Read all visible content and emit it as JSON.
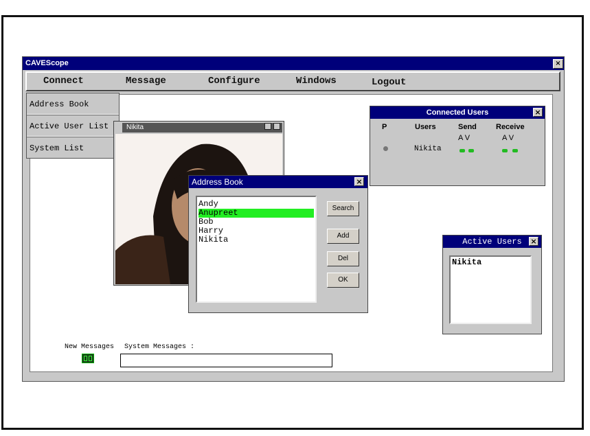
{
  "window": {
    "title": "CAVEScope",
    "close_glyph": "×"
  },
  "menubar": {
    "items": [
      {
        "label": "Connect"
      },
      {
        "label": "Message"
      },
      {
        "label": "Configure"
      },
      {
        "label": "Windows"
      },
      {
        "label": "Logout"
      }
    ]
  },
  "connect_menu": {
    "items": [
      {
        "label": "Address Book"
      },
      {
        "label": "Active User List"
      },
      {
        "label": "System List"
      }
    ]
  },
  "video_window": {
    "title": "Nikita"
  },
  "address_book": {
    "title": "Address Book",
    "close_glyph": "×",
    "entries": [
      "Andy",
      "Anupreet",
      "Bob",
      "Harry",
      "Nikita"
    ],
    "selected_index": 1,
    "buttons": {
      "search": "Search",
      "add": "Add",
      "del": "Del",
      "ok": "OK"
    }
  },
  "connected_users": {
    "title": "Connected Users",
    "close_glyph": "×",
    "headers": {
      "p": "P",
      "users": "Users",
      "send": "Send",
      "receive": "Receive"
    },
    "send_sub": "A  V",
    "receive_sub": "A  V",
    "rows": [
      {
        "user": "Nikita"
      }
    ]
  },
  "active_users": {
    "title": "Active Users",
    "close_glyph": "×",
    "entries": [
      "Nikita"
    ]
  },
  "status": {
    "new_messages_label": "New Messages",
    "system_messages_label": "System Messages :",
    "system_messages_value": ""
  },
  "colors": {
    "titlebar": "#00007a",
    "selection": "#22ee22",
    "chrome": "#c8c8c8"
  }
}
